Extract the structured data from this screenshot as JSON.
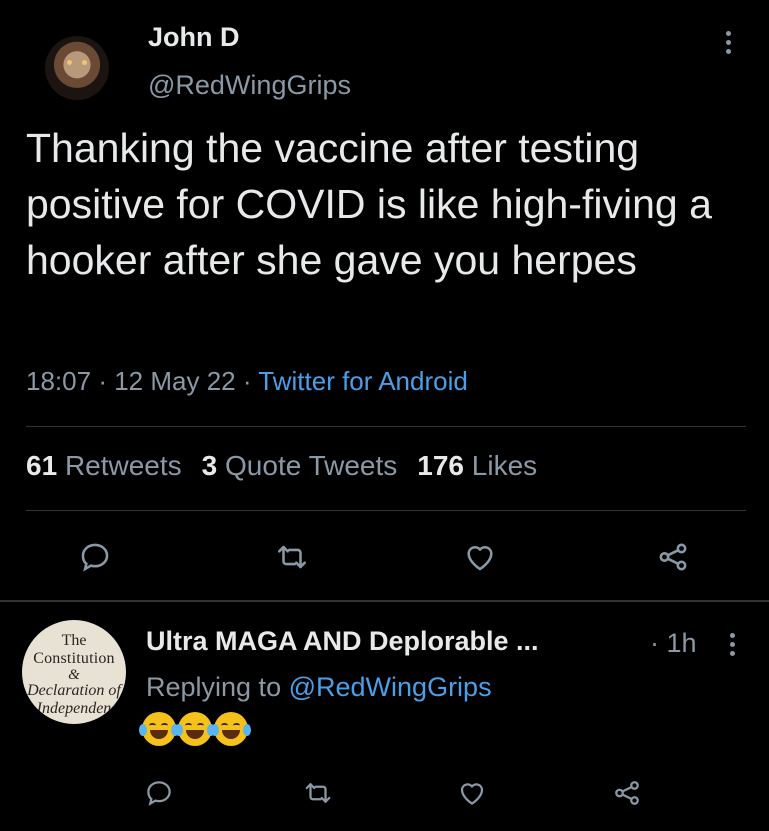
{
  "tweet": {
    "author_name": "John D",
    "author_handle": "@RedWingGrips",
    "text": "Thanking the vaccine after testing positive for COVID is like high-fiving a hooker after she gave you herpes",
    "time": "18:07",
    "date": "12 May 22",
    "source": "Twitter for Android",
    "separator": "·",
    "stats": {
      "retweets_count": "61",
      "retweets_label": "Retweets",
      "quotes_count": "3",
      "quotes_label": "Quote Tweets",
      "likes_count": "176",
      "likes_label": "Likes"
    },
    "actions": [
      "reply-icon",
      "retweet-icon",
      "like-icon",
      "share-icon"
    ]
  },
  "reply": {
    "author_name": "Ultra MAGA AND Deplorable ...",
    "time": "· 1h",
    "replying_prefix": "Replying to",
    "replying_to": "@RedWingGrips",
    "emojis": [
      "rolling-on-floor-laughing",
      "rolling-on-floor-laughing",
      "rolling-on-floor-laughing"
    ],
    "avatar_text": {
      "line1": "The",
      "line2": "Constitution",
      "line3": "&",
      "line4": "Declaration of",
      "line5": "Independen"
    }
  },
  "colors": {
    "background": "#000000",
    "text": "#e7e9ea",
    "secondary": "#8b98a5",
    "link": "#4a9fe8",
    "divider": "#2f3336"
  }
}
